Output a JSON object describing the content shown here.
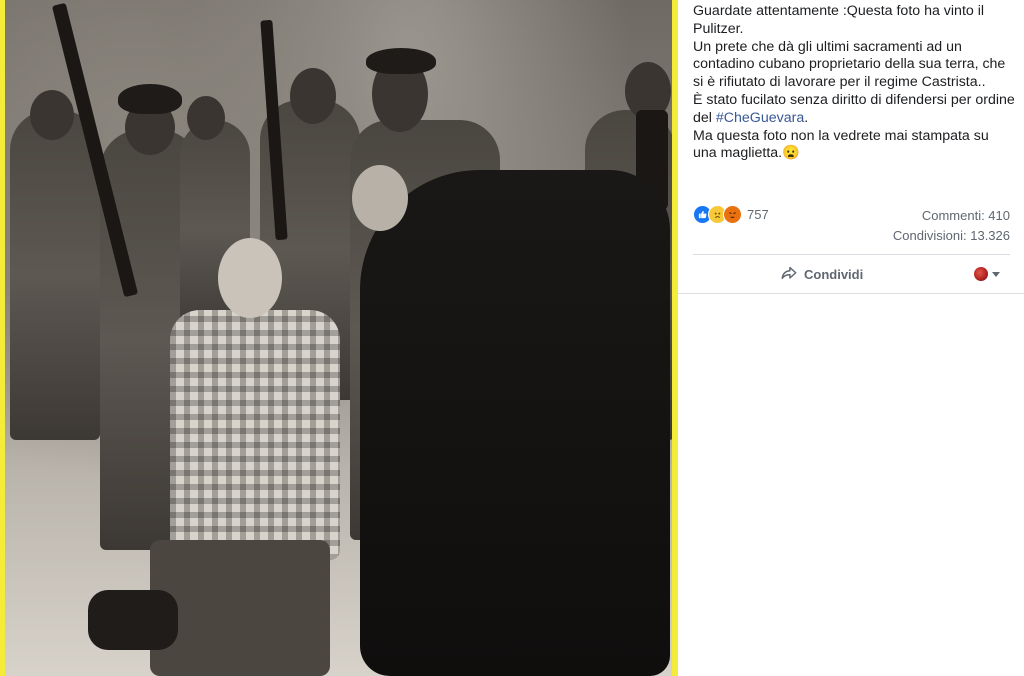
{
  "post": {
    "line1": "Guardate attentamente :Questa foto ha vinto il Pulitzer.",
    "line2": "Un prete che dà gli ultimi sacramenti ad un contadino cubano proprietario della sua terra, che si è rifiutato di lavorare per il regime Castrista..",
    "line3_prefix": "È stato fucilato senza diritto di difendersi per ordine del ",
    "hashtag": "#CheGuevara",
    "line3_suffix": ".",
    "line4": "Ma questa foto non la vedrete mai stampata su una maglietta.",
    "emoji": "😦"
  },
  "reactions": {
    "icons": [
      "like-icon",
      "sad-icon",
      "angry-icon"
    ],
    "count": "757"
  },
  "stats": {
    "comments": "Commenti: 410",
    "shares": "Condivisioni: 13.326"
  },
  "actions": {
    "share_label": "Condividi"
  },
  "colors": {
    "photo_border": "#f5ec3a",
    "hashtag": "#385898",
    "secondary_text": "#606770"
  }
}
